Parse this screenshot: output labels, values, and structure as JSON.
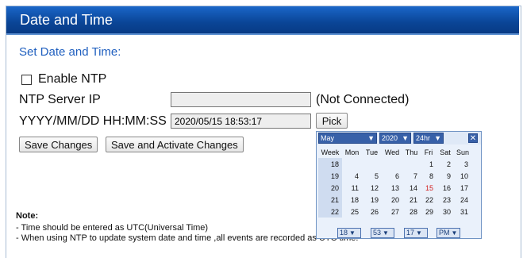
{
  "window": {
    "title": "Date and Time"
  },
  "section_title": "Set Date and Time:",
  "ntp": {
    "checkbox_label": "Enable NTP"
  },
  "server": {
    "label": "NTP Server IP",
    "value": "",
    "status": "(Not Connected)"
  },
  "datetime": {
    "label": "YYYY/MM/DD HH:MM:SS",
    "value": "2020/05/15 18:53:17",
    "pick_label": "Pick"
  },
  "buttons": {
    "save": "Save Changes",
    "save_activate": "Save and Activate Changes"
  },
  "note": {
    "title": "Note:",
    "lines": [
      "- Time should be entered as UTC(Universal Time)",
      "- When using NTP to update system date and time ,all events are recorded as UTC time."
    ]
  },
  "calendar": {
    "month": "May",
    "year": "2020",
    "mode": "24hr",
    "close": "✕",
    "headers": [
      "Week",
      "Mon",
      "Tue",
      "Wed",
      "Thu",
      "Fri",
      "Sat",
      "Sun"
    ],
    "weeks": [
      {
        "week": "18",
        "days": [
          "",
          "",
          "",
          "",
          "1",
          "2",
          "3"
        ]
      },
      {
        "week": "19",
        "days": [
          "4",
          "5",
          "6",
          "7",
          "8",
          "9",
          "10"
        ]
      },
      {
        "week": "20",
        "days": [
          "11",
          "12",
          "13",
          "14",
          "15",
          "16",
          "17"
        ]
      },
      {
        "week": "21",
        "days": [
          "18",
          "19",
          "20",
          "21",
          "22",
          "23",
          "24"
        ]
      },
      {
        "week": "22",
        "days": [
          "25",
          "26",
          "27",
          "28",
          "29",
          "30",
          "31"
        ]
      }
    ],
    "highlight_day": "15",
    "time": {
      "hour": "18",
      "minute": "53",
      "second": "17",
      "ampm": "PM"
    }
  },
  "colors": {
    "title_bar": "#0a4597",
    "accent_text": "#1f5fbf",
    "today": "#d21f1f"
  }
}
